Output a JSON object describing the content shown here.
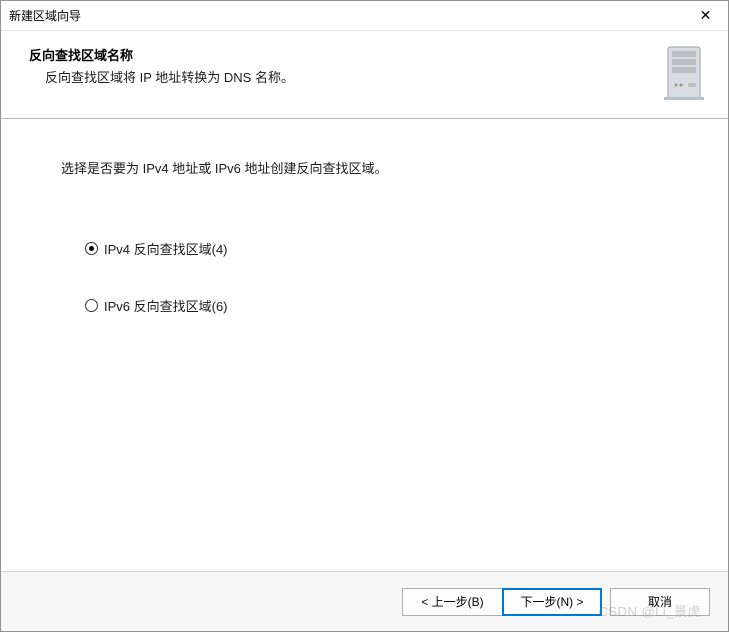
{
  "window": {
    "title": "新建区域向导",
    "close_icon": "✕"
  },
  "header": {
    "title": "反向查找区域名称",
    "subtitle": "反向查找区域将 IP 地址转换为 DNS 名称。"
  },
  "content": {
    "instruction": "选择是否要为 IPv4 地址或 IPv6 地址创建反向查找区域。",
    "options": {
      "ipv4": {
        "label": "IPv4 反向查找区域(4)",
        "selected": true
      },
      "ipv6": {
        "label": "IPv6 反向查找区域(6)",
        "selected": false
      }
    }
  },
  "footer": {
    "back": "< 上一步(B)",
    "next": "下一步(N) >",
    "cancel": "取消"
  },
  "watermark": "CSDN @Li_景虎"
}
